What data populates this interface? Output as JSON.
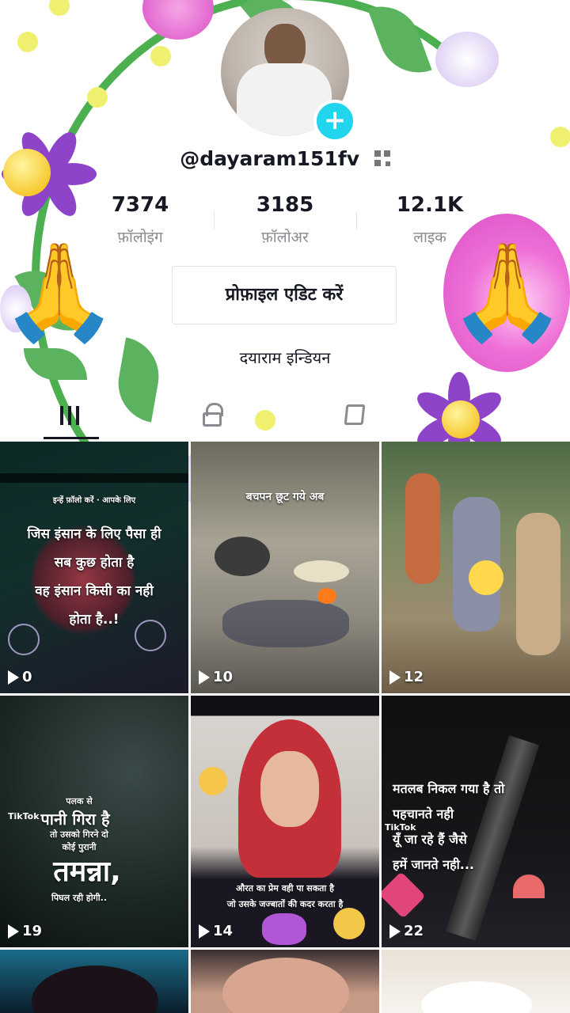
{
  "profile": {
    "username": "@dayaram151fv",
    "bio": "दयाराम इन्डियन",
    "edit_button": "प्रोफ़ाइल एडिट करें"
  },
  "stats": [
    {
      "value": "7374",
      "label": "फ़ॉलोइंग"
    },
    {
      "value": "3185",
      "label": "फ़ॉलोअर"
    },
    {
      "value": "12.1K",
      "label": "लाइक"
    }
  ],
  "tabs": [
    "videos-grid",
    "private",
    "tagged",
    "liked"
  ],
  "videos": [
    {
      "views": "0",
      "overlay_lines": [
        "जिस इंसान के लिए पैसा ही",
        "सब कुछ होता है",
        "वह इंसान किसी का नही",
        "होता है..!"
      ],
      "top_text": "इन्हें फ़ॉलो करें · आपके लिए"
    },
    {
      "views": "10",
      "overlay_lines": [
        "बचपन छूट गये अब"
      ]
    },
    {
      "views": "12",
      "overlay_lines": []
    },
    {
      "views": "19",
      "overlay_lines": [
        "पलक से",
        "पानी गिरा है",
        "तो उसको गिरने दो",
        "कोई पुरानी",
        "तमन्ना,",
        "पिघल रही होगी.."
      ],
      "mark": "TikTok"
    },
    {
      "views": "14",
      "overlay_lines": [
        "औरत का प्रेम वही पा सकता है",
        "जो उसके जज्बातों की कदर करता है"
      ]
    },
    {
      "views": "22",
      "overlay_lines": [
        "मतलब निकल गया है तो",
        "पहचानते नही",
        "यूँ जा रहे हैं जैसे",
        "हमें जानते नही..."
      ],
      "mark": "TikTok"
    }
  ],
  "colors": {
    "accent": "#20d5ec",
    "text": "#161823",
    "muted": "#8a8b91"
  }
}
